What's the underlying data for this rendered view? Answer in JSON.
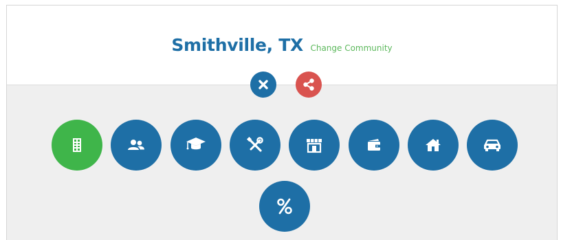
{
  "header": {
    "city": "Smithville, TX",
    "change_community_label": "Change Community"
  },
  "actions": [
    {
      "name": "close",
      "icon": "close-icon",
      "color": "#1e6fa6"
    },
    {
      "name": "share",
      "icon": "share-icon",
      "color": "#d9534f"
    }
  ],
  "categories": [
    {
      "icon": "directory-icon",
      "active": true,
      "color": "#3fb54a"
    },
    {
      "icon": "people-icon",
      "active": false,
      "color": "#1e6fa6"
    },
    {
      "icon": "graduation-cap-icon",
      "active": false,
      "color": "#1e6fa6"
    },
    {
      "icon": "tools-icon",
      "active": false,
      "color": "#1e6fa6"
    },
    {
      "icon": "storefront-icon",
      "active": false,
      "color": "#1e6fa6"
    },
    {
      "icon": "wallet-icon",
      "active": false,
      "color": "#1e6fa6"
    },
    {
      "icon": "home-icon",
      "active": false,
      "color": "#1e6fa6"
    },
    {
      "icon": "car-icon",
      "active": false,
      "color": "#1e6fa6"
    },
    {
      "icon": "percent-icon",
      "active": false,
      "color": "#1e6fa6"
    }
  ],
  "colors": {
    "primary": "#1e6fa6",
    "accent_green": "#3fb54a",
    "link_green": "#5cb85c",
    "share_red": "#d9534f",
    "background_gray": "#efefef"
  }
}
